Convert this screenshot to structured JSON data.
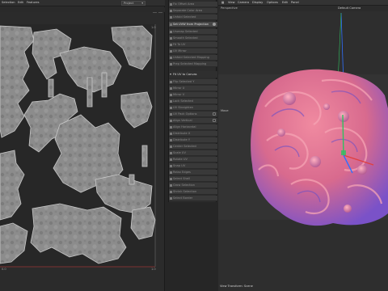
{
  "uv_editor": {
    "menus": [
      "Selection",
      "Edit",
      "Features"
    ],
    "dropdown_value": "Project",
    "corner_labels": {
      "top_right": "1.0",
      "bottom_left": "0.0",
      "bottom_right": "1.0"
    }
  },
  "tool_panel": {
    "top_rows": [
      {
        "label": "Fix Offset Area"
      },
      {
        "label": "Separate Color Area"
      },
      {
        "label": "Unfold Selected"
      }
    ],
    "projection_row": {
      "label": "Set UVW from Projection"
    },
    "mid_rows": [
      {
        "label": "Unwrap Selected"
      },
      {
        "label": "Smooth Selected"
      },
      {
        "label": "Fit To UV"
      },
      {
        "label": "UV Mirror"
      },
      {
        "label": "Unfold Selected Mapping"
      },
      {
        "label": "Prep Selected Mapping"
      }
    ],
    "section_label": "Fit UV to Canvas",
    "lower_rows": [
      {
        "label": "Flip Selected Y"
      },
      {
        "label": "Mirror U"
      },
      {
        "label": "Mirror V"
      },
      {
        "label": "Lock Selected"
      },
      {
        "label": "UV Straighten"
      },
      {
        "label": "UV Pack Options"
      },
      {
        "label": "Align Vertical"
      },
      {
        "label": "Align Horizontal"
      },
      {
        "label": "Distribute X"
      },
      {
        "label": "Distribute Y"
      },
      {
        "label": "Center Selected"
      },
      {
        "label": "Scale UV"
      },
      {
        "label": "Rotate UV"
      },
      {
        "label": "Snap UV"
      },
      {
        "label": "Relax Edges"
      },
      {
        "label": "Select Shell"
      },
      {
        "label": "Grow Selection"
      },
      {
        "label": "Shrink Selection"
      },
      {
        "label": "Select Border"
      },
      {
        "label": "Invert Selection"
      },
      {
        "label": "Hide Selected"
      },
      {
        "label": "Show All"
      }
    ]
  },
  "viewport": {
    "menus": [
      "View",
      "Camera",
      "Display",
      "Options",
      "Edit",
      "Panel"
    ],
    "projection": "Perspective",
    "camera_label": "Default Camera",
    "tool_label": "Move",
    "bottom_status": "View Transform: Scene",
    "colors": {
      "model_base": "#e07290",
      "model_shadow": "#6b4fd0",
      "gizmo_x": "#e04040",
      "gizmo_y": "#30c060",
      "gizmo_z": "#3070ff"
    }
  }
}
